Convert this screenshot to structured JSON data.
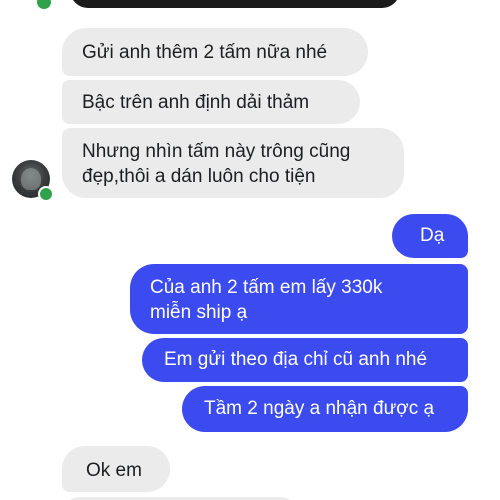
{
  "conversation": {
    "incoming": [
      {
        "text": "Gửi anh thêm 2 tấm nữa nhé"
      },
      {
        "text": "Bậc trên anh định dải thảm"
      },
      {
        "text": "Nhưng nhìn tấm này trông cũng\nđẹp,thôi a dán luôn cho tiện"
      }
    ],
    "outgoing": [
      {
        "text": "Dạ"
      },
      {
        "text": "Của anh 2 tấm em lấy 330k\nmiễn ship ạ"
      },
      {
        "text": "Em gửi theo địa chỉ cũ anh nhé"
      },
      {
        "text": "Tầm 2 ngày a nhận được ạ"
      }
    ],
    "reply": {
      "text": "Ok em"
    }
  },
  "colors": {
    "incoming_bubble": "#ebebeb",
    "outgoing_bubble": "#3b4bf0",
    "online_indicator": "#31a24c"
  },
  "icons": {
    "avatar": "contact-avatar",
    "status": "online-status-dot"
  }
}
